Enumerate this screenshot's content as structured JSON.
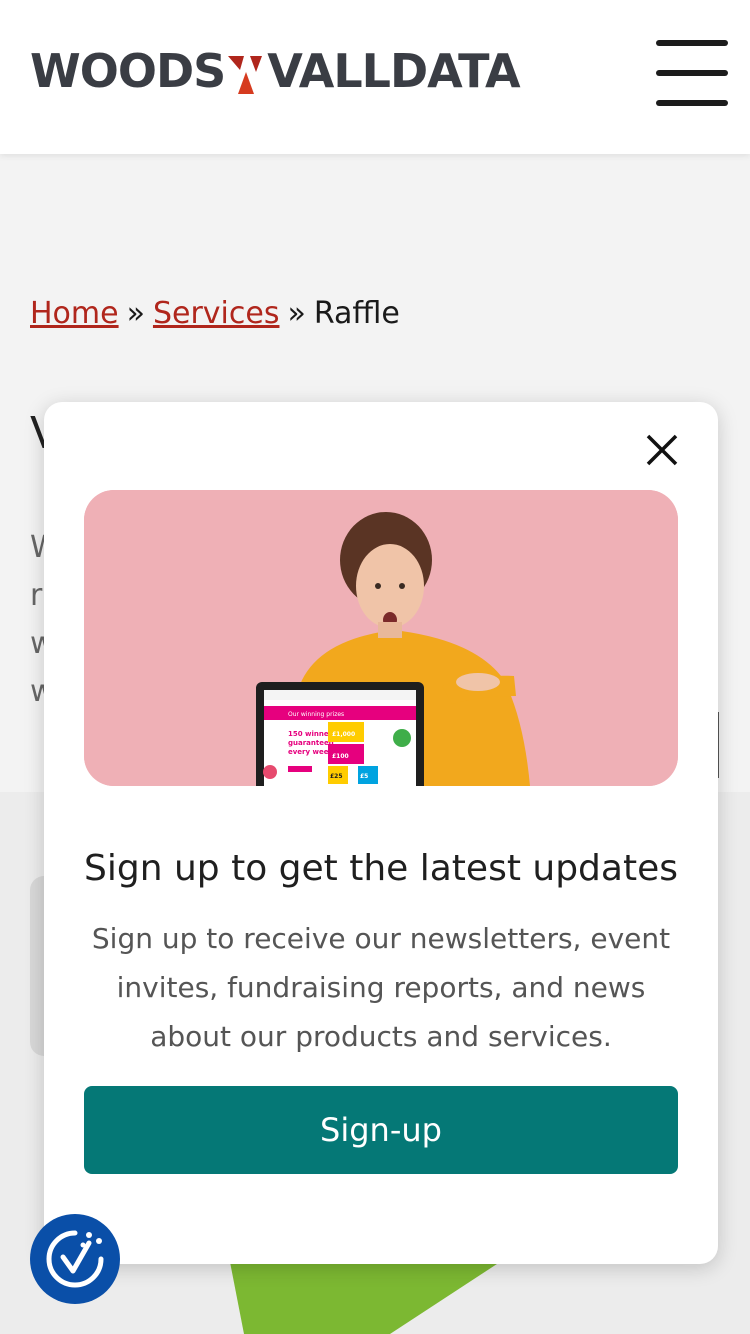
{
  "header": {
    "logo_left": "WOODS",
    "logo_right": "VALLDATA",
    "menu_icon": "hamburger-menu-icon"
  },
  "breadcrumb": {
    "home": "Home",
    "separator": "»",
    "services": "Services",
    "current": "Raffle"
  },
  "background_peek": {
    "heading_char": "V",
    "line_chars": [
      "W",
      "r",
      "w",
      "w"
    ]
  },
  "modal": {
    "close_icon": "close-icon",
    "title": "Sign up to get the latest updates",
    "body": "Sign up to receive our newsletters, event invites, fundraising reports, and news about our products and services.",
    "button_label": "Sign-up",
    "laptop_screen": {
      "banner": "Our winning prizes",
      "headline_1": "150 winners",
      "headline_2": "guaranteed",
      "headline_3": "every week",
      "prize_1": "£1,000",
      "prize_2": "£100",
      "prize_3": "£25",
      "prize_4": "£5"
    }
  },
  "accessibility": {
    "icon": "accessibility-icon"
  },
  "colors": {
    "brand_red": "#b0261c",
    "logo_dark": "#3a3d44",
    "button_teal": "#057876",
    "a11y_blue": "#0a4fa8",
    "hero_pink": "#efb0b6",
    "accent_green": "#7cb832"
  }
}
